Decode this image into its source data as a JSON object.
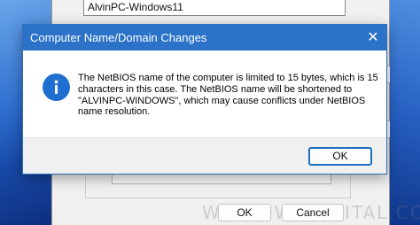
{
  "parent": {
    "computer_name": "AlvinPC-Windows11",
    "ok_label": "OK",
    "cancel_label": "Cancel",
    "watermark": "WINDOWSDIGITAL.COM"
  },
  "dialog": {
    "title": "Computer Name/Domain Changes",
    "close_glyph": "✕",
    "message": "The NetBIOS name of the computer is limited to 15 bytes, which is 15 characters in this case.  The NetBIOS name will be shortened to \"ALVINPC-WINDOWS\", which may cause conflicts under NetBIOS name resolution.",
    "ok_label": "OK",
    "icon": "info-icon",
    "accent_color": "#2b72c8"
  }
}
